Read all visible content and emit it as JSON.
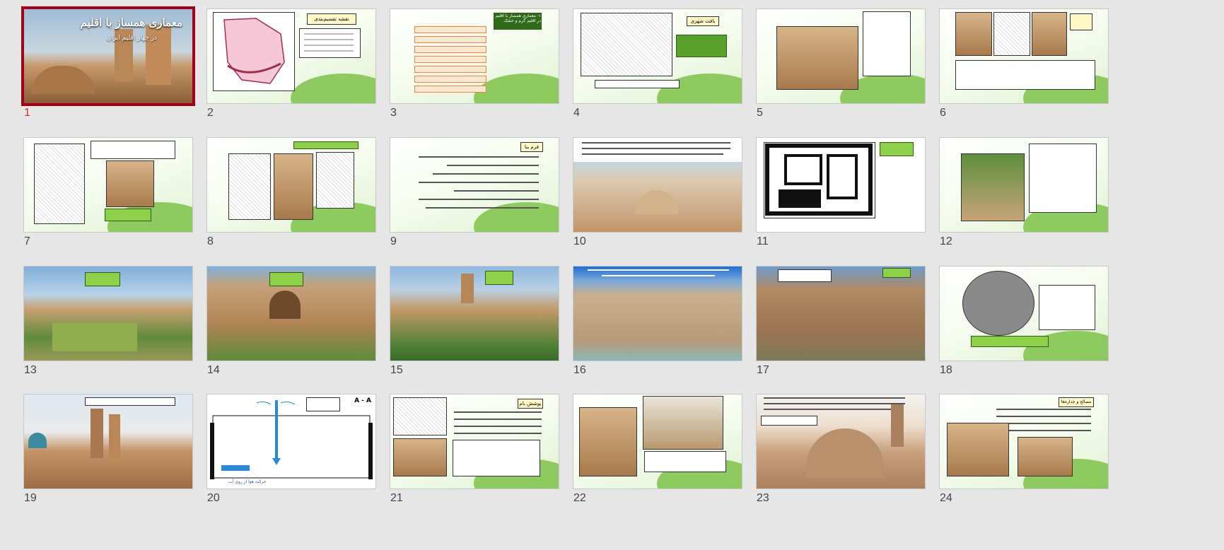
{
  "presentation": {
    "selected_slide": 1
  },
  "slides": [
    {
      "number": "1",
      "title": "معماری همساز با اقلیم",
      "subtitle": "در چهار اقلیم ایران"
    },
    {
      "number": "2",
      "title": "نقشه تقسیم‌بندی اقلیمی ایران"
    },
    {
      "number": "3",
      "title": "۱- معماری همساز با اقلیم در اقلیم گرم و خشک"
    },
    {
      "number": "4",
      "title": "بافت شهری"
    },
    {
      "number": "5"
    },
    {
      "number": "6"
    },
    {
      "number": "7"
    },
    {
      "number": "8"
    },
    {
      "number": "9",
      "title": "فرم بنا"
    },
    {
      "number": "10"
    },
    {
      "number": "11"
    },
    {
      "number": "12"
    },
    {
      "number": "13"
    },
    {
      "number": "14"
    },
    {
      "number": "15"
    },
    {
      "number": "16"
    },
    {
      "number": "17"
    },
    {
      "number": "18"
    },
    {
      "number": "19"
    },
    {
      "number": "20",
      "title": "A - A",
      "caption": "حرکت هوا از روی آب"
    },
    {
      "number": "21",
      "title": "پوشش بام"
    },
    {
      "number": "22"
    },
    {
      "number": "23"
    },
    {
      "number": "24",
      "title": "مصالح و جداره‌ها"
    }
  ],
  "colors": {
    "selected_outline": "#a0001c",
    "selected_number": "#c0392b",
    "accent_green": "#8ed04a"
  }
}
